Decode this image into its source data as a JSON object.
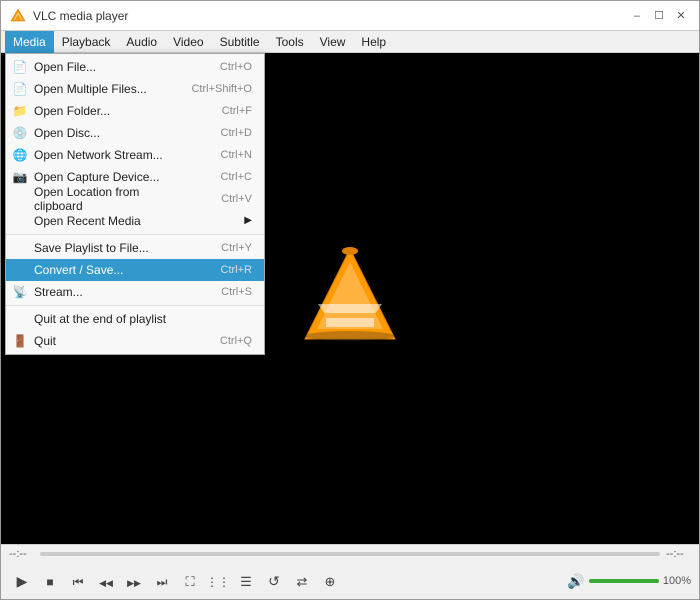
{
  "window": {
    "title": "VLC media player",
    "app_name": "VLC media player"
  },
  "title_controls": {
    "minimize": "–",
    "maximize": "☐",
    "close": "✕"
  },
  "menubar": {
    "items": [
      {
        "id": "media",
        "label": "Media",
        "active": true
      },
      {
        "id": "playback",
        "label": "Playback",
        "active": false
      },
      {
        "id": "audio",
        "label": "Audio",
        "active": false
      },
      {
        "id": "video",
        "label": "Video",
        "active": false
      },
      {
        "id": "subtitle",
        "label": "Subtitle",
        "active": false
      },
      {
        "id": "tools",
        "label": "Tools",
        "active": false
      },
      {
        "id": "view",
        "label": "View",
        "active": false
      },
      {
        "id": "help",
        "label": "Help",
        "active": false
      }
    ]
  },
  "media_menu": {
    "items": [
      {
        "id": "open-file",
        "label": "Open File...",
        "shortcut": "Ctrl+O",
        "has_icon": true
      },
      {
        "id": "open-multiple",
        "label": "Open Multiple Files...",
        "shortcut": "Ctrl+Shift+O",
        "has_icon": true
      },
      {
        "id": "open-folder",
        "label": "Open Folder...",
        "shortcut": "Ctrl+F",
        "has_icon": true
      },
      {
        "id": "open-disc",
        "label": "Open Disc...",
        "shortcut": "Ctrl+D",
        "has_icon": true
      },
      {
        "id": "open-network",
        "label": "Open Network Stream...",
        "shortcut": "Ctrl+N",
        "has_icon": true
      },
      {
        "id": "open-capture",
        "label": "Open Capture Device...",
        "shortcut": "Ctrl+C",
        "has_icon": true
      },
      {
        "id": "open-location",
        "label": "Open Location from clipboard",
        "shortcut": "Ctrl+V",
        "has_icon": false
      },
      {
        "id": "open-recent",
        "label": "Open Recent Media",
        "shortcut": "",
        "has_submenu": true
      },
      {
        "id": "sep1",
        "type": "separator"
      },
      {
        "id": "save-playlist",
        "label": "Save Playlist to File...",
        "shortcut": "Ctrl+Y",
        "has_icon": false
      },
      {
        "id": "convert-save",
        "label": "Convert / Save...",
        "shortcut": "Ctrl+R",
        "highlighted": true
      },
      {
        "id": "stream",
        "label": "Stream...",
        "shortcut": "Ctrl+S",
        "has_icon": true
      },
      {
        "id": "sep2",
        "type": "separator"
      },
      {
        "id": "quit-end",
        "label": "Quit at the end of playlist",
        "shortcut": "",
        "has_icon": false
      },
      {
        "id": "quit",
        "label": "Quit",
        "shortcut": "Ctrl+Q",
        "has_icon": true
      }
    ]
  },
  "bottom": {
    "time_start": "--:--",
    "time_end": "--:--",
    "volume_pct": "100%",
    "volume_level": 100
  }
}
